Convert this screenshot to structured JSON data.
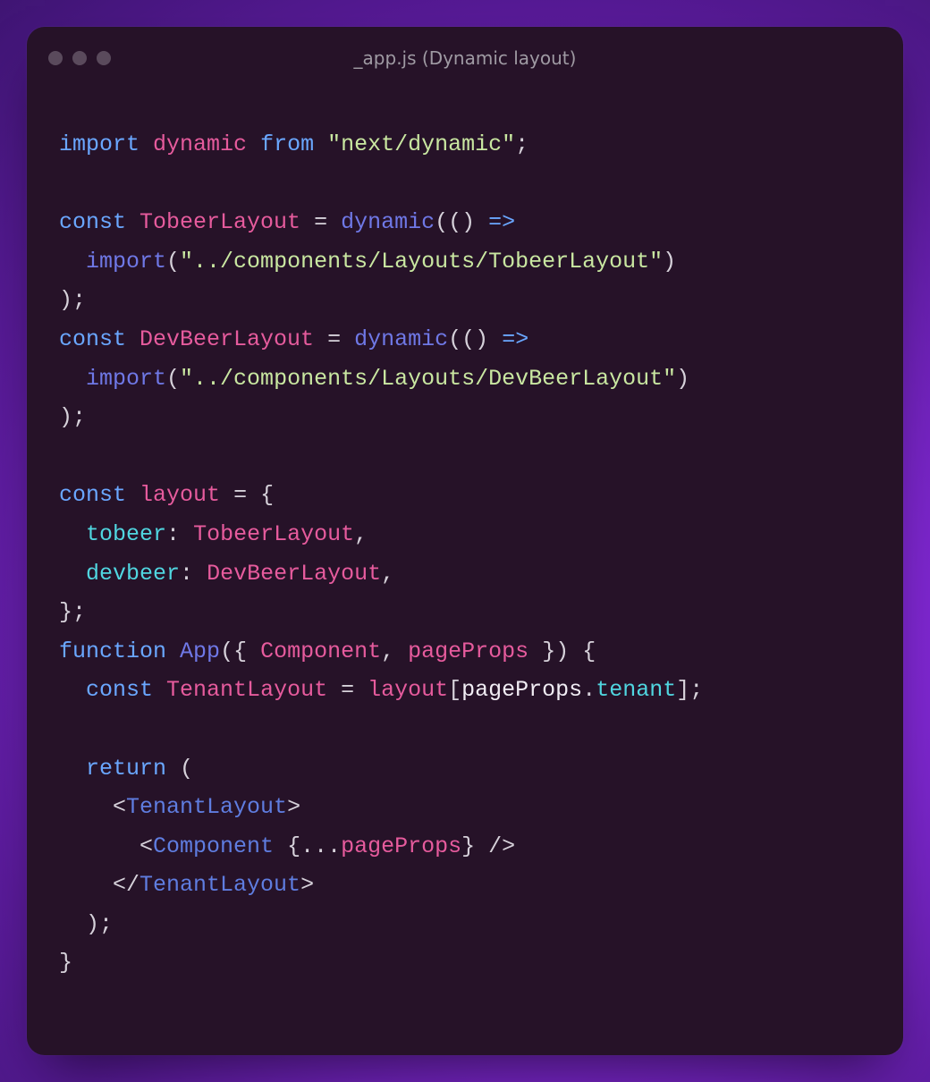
{
  "window": {
    "title": "_app.js (Dynamic layout)"
  },
  "colors": {
    "keyword": "#6aa7ff",
    "identifier": "#e65b9d",
    "funcname": "#6f78e6",
    "string": "#c9e7a1",
    "punct": "#d6d1da",
    "property": "#50d6e0",
    "tag": "#5f7de0",
    "plain": "#f1edf4",
    "windowBg": "#261228"
  },
  "code": {
    "lines": [
      [
        {
          "t": "kw",
          "v": "import"
        },
        {
          "t": "sp",
          "v": " "
        },
        {
          "t": "id",
          "v": "dynamic"
        },
        {
          "t": "sp",
          "v": " "
        },
        {
          "t": "kw",
          "v": "from"
        },
        {
          "t": "sp",
          "v": " "
        },
        {
          "t": "str",
          "v": "\"next/dynamic\""
        },
        {
          "t": "punct",
          "v": ";"
        }
      ],
      [],
      [
        {
          "t": "kw",
          "v": "const"
        },
        {
          "t": "sp",
          "v": " "
        },
        {
          "t": "id",
          "v": "TobeerLayout"
        },
        {
          "t": "sp",
          "v": " "
        },
        {
          "t": "punct",
          "v": "="
        },
        {
          "t": "sp",
          "v": " "
        },
        {
          "t": "fn",
          "v": "dynamic"
        },
        {
          "t": "punct",
          "v": "(()"
        },
        {
          "t": "sp",
          "v": " "
        },
        {
          "t": "kw",
          "v": "=>"
        }
      ],
      [
        {
          "t": "sp",
          "v": "  "
        },
        {
          "t": "fn",
          "v": "import"
        },
        {
          "t": "punct",
          "v": "("
        },
        {
          "t": "str",
          "v": "\"../components/Layouts/TobeerLayout\""
        },
        {
          "t": "punct",
          "v": ")"
        }
      ],
      [
        {
          "t": "punct",
          "v": ");"
        }
      ],
      [
        {
          "t": "kw",
          "v": "const"
        },
        {
          "t": "sp",
          "v": " "
        },
        {
          "t": "id",
          "v": "DevBeerLayout"
        },
        {
          "t": "sp",
          "v": " "
        },
        {
          "t": "punct",
          "v": "="
        },
        {
          "t": "sp",
          "v": " "
        },
        {
          "t": "fn",
          "v": "dynamic"
        },
        {
          "t": "punct",
          "v": "(()"
        },
        {
          "t": "sp",
          "v": " "
        },
        {
          "t": "kw",
          "v": "=>"
        }
      ],
      [
        {
          "t": "sp",
          "v": "  "
        },
        {
          "t": "fn",
          "v": "import"
        },
        {
          "t": "punct",
          "v": "("
        },
        {
          "t": "str",
          "v": "\"../components/Layouts/DevBeerLayout\""
        },
        {
          "t": "punct",
          "v": ")"
        }
      ],
      [
        {
          "t": "punct",
          "v": ");"
        }
      ],
      [],
      [
        {
          "t": "kw",
          "v": "const"
        },
        {
          "t": "sp",
          "v": " "
        },
        {
          "t": "id",
          "v": "layout"
        },
        {
          "t": "sp",
          "v": " "
        },
        {
          "t": "punct",
          "v": "="
        },
        {
          "t": "sp",
          "v": " "
        },
        {
          "t": "punct",
          "v": "{"
        }
      ],
      [
        {
          "t": "sp",
          "v": "  "
        },
        {
          "t": "prop",
          "v": "tobeer"
        },
        {
          "t": "punct",
          "v": ":"
        },
        {
          "t": "sp",
          "v": " "
        },
        {
          "t": "id",
          "v": "TobeerLayout"
        },
        {
          "t": "punct",
          "v": ","
        }
      ],
      [
        {
          "t": "sp",
          "v": "  "
        },
        {
          "t": "prop",
          "v": "devbeer"
        },
        {
          "t": "punct",
          "v": ":"
        },
        {
          "t": "sp",
          "v": " "
        },
        {
          "t": "id",
          "v": "DevBeerLayout"
        },
        {
          "t": "punct",
          "v": ","
        }
      ],
      [
        {
          "t": "punct",
          "v": "};"
        }
      ],
      [
        {
          "t": "kw",
          "v": "function"
        },
        {
          "t": "sp",
          "v": " "
        },
        {
          "t": "fn",
          "v": "App"
        },
        {
          "t": "punct",
          "v": "({"
        },
        {
          "t": "sp",
          "v": " "
        },
        {
          "t": "id",
          "v": "Component"
        },
        {
          "t": "punct",
          "v": ","
        },
        {
          "t": "sp",
          "v": " "
        },
        {
          "t": "id",
          "v": "pageProps"
        },
        {
          "t": "sp",
          "v": " "
        },
        {
          "t": "punct",
          "v": "})"
        },
        {
          "t": "sp",
          "v": " "
        },
        {
          "t": "punct",
          "v": "{"
        }
      ],
      [
        {
          "t": "sp",
          "v": "  "
        },
        {
          "t": "kw",
          "v": "const"
        },
        {
          "t": "sp",
          "v": " "
        },
        {
          "t": "id",
          "v": "TenantLayout"
        },
        {
          "t": "sp",
          "v": " "
        },
        {
          "t": "punct",
          "v": "="
        },
        {
          "t": "sp",
          "v": " "
        },
        {
          "t": "id",
          "v": "layout"
        },
        {
          "t": "punct",
          "v": "["
        },
        {
          "t": "white",
          "v": "pageProps"
        },
        {
          "t": "punct",
          "v": "."
        },
        {
          "t": "prop",
          "v": "tenant"
        },
        {
          "t": "punct",
          "v": "];"
        }
      ],
      [],
      [
        {
          "t": "sp",
          "v": "  "
        },
        {
          "t": "kw",
          "v": "return"
        },
        {
          "t": "sp",
          "v": " "
        },
        {
          "t": "punct",
          "v": "("
        }
      ],
      [
        {
          "t": "sp",
          "v": "    "
        },
        {
          "t": "punct",
          "v": "<"
        },
        {
          "t": "tag",
          "v": "TenantLayout"
        },
        {
          "t": "punct",
          "v": ">"
        }
      ],
      [
        {
          "t": "sp",
          "v": "      "
        },
        {
          "t": "punct",
          "v": "<"
        },
        {
          "t": "tag",
          "v": "Component"
        },
        {
          "t": "sp",
          "v": " "
        },
        {
          "t": "punct",
          "v": "{..."
        },
        {
          "t": "id",
          "v": "pageProps"
        },
        {
          "t": "punct",
          "v": "}"
        },
        {
          "t": "sp",
          "v": " "
        },
        {
          "t": "punct",
          "v": "/>"
        }
      ],
      [
        {
          "t": "sp",
          "v": "    "
        },
        {
          "t": "punct",
          "v": "</"
        },
        {
          "t": "tag",
          "v": "TenantLayout"
        },
        {
          "t": "punct",
          "v": ">"
        }
      ],
      [
        {
          "t": "sp",
          "v": "  "
        },
        {
          "t": "punct",
          "v": ");"
        }
      ],
      [
        {
          "t": "punct",
          "v": "}"
        }
      ]
    ]
  }
}
